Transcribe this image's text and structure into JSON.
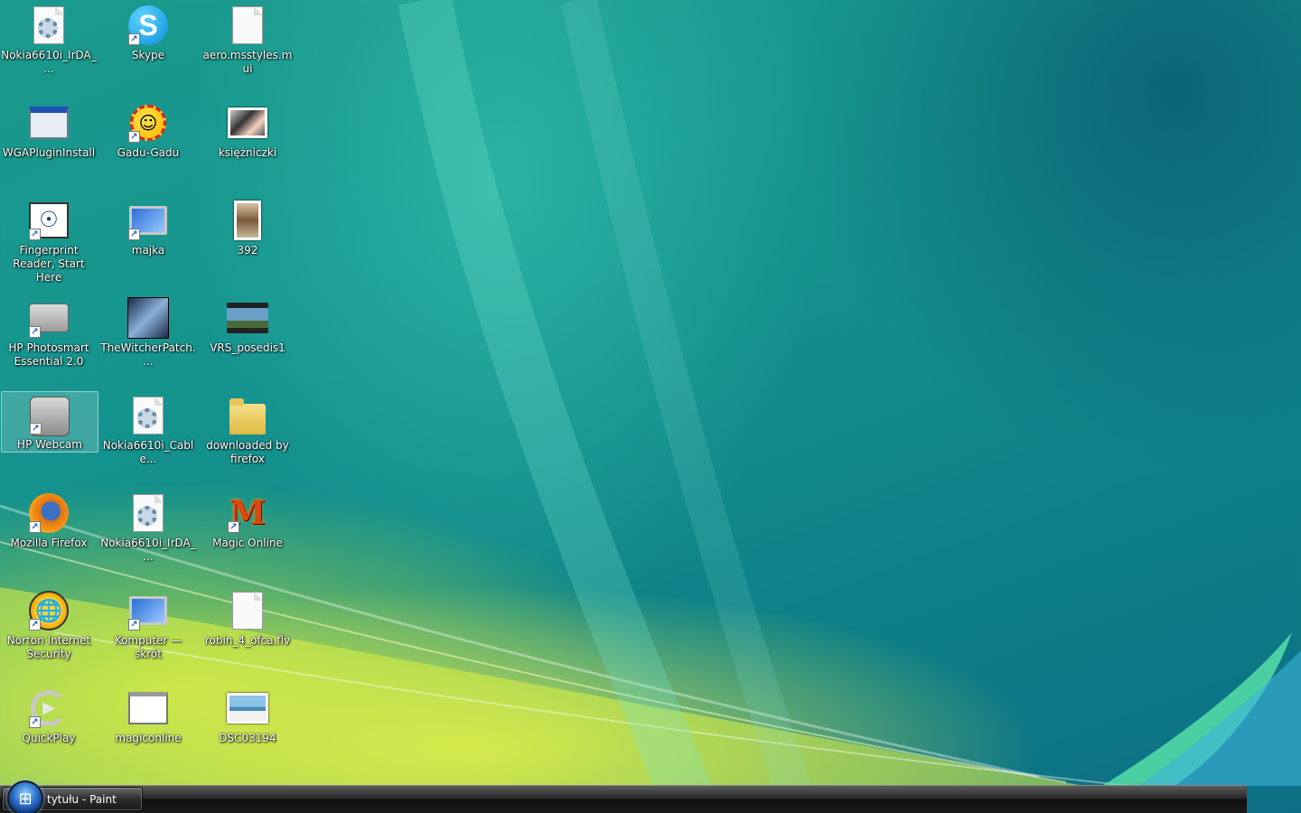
{
  "desktop": {
    "icons": [
      {
        "label": "Nokia6610i_IrDA_...",
        "icon": "settings-file-icon",
        "shortcut": false
      },
      {
        "label": "Skype",
        "icon": "skype-icon",
        "shortcut": true
      },
      {
        "label": "aero.msstyles.mui",
        "icon": "blank-file-icon",
        "shortcut": false
      },
      {
        "label": "WGAPluginInstall",
        "icon": "installer-icon",
        "shortcut": false
      },
      {
        "label": "Gadu-Gadu",
        "icon": "gadu-gadu-icon",
        "shortcut": true
      },
      {
        "label": "księżniczki",
        "icon": "photo-icon",
        "shortcut": false
      },
      {
        "label": "Fingerprint Reader, Start Here",
        "icon": "fingerprint-reader-icon",
        "shortcut": true
      },
      {
        "label": "majka",
        "icon": "computer-icon",
        "shortcut": true
      },
      {
        "label": "392",
        "icon": "photo-icon",
        "shortcut": false
      },
      {
        "label": "HP Photosmart Essential 2.0",
        "icon": "camera-icon",
        "shortcut": true
      },
      {
        "label": "TheWitcherPatch....",
        "icon": "witcher-patch-icon",
        "shortcut": false
      },
      {
        "label": "VRS_posedis1",
        "icon": "video-icon",
        "shortcut": false
      },
      {
        "label": "HP Webcam",
        "icon": "webcam-icon",
        "shortcut": true
      },
      {
        "label": "Nokia6610i_Cable...",
        "icon": "settings-file-icon",
        "shortcut": false
      },
      {
        "label": "downloaded by firefox",
        "icon": "folder-icon",
        "shortcut": false
      },
      {
        "label": "Mozilla Firefox",
        "icon": "firefox-icon",
        "shortcut": true
      },
      {
        "label": "Nokia6610i_IrDA_...",
        "icon": "settings-file-icon",
        "shortcut": false
      },
      {
        "label": "Magic Online",
        "icon": "magic-online-icon",
        "shortcut": true
      },
      {
        "label": "Norton Internet Security",
        "icon": "norton-icon",
        "shortcut": true
      },
      {
        "label": "Komputer — skrót",
        "icon": "computer-icon",
        "shortcut": true
      },
      {
        "label": "robin_4_ofca.flv",
        "icon": "blank-file-icon",
        "shortcut": false
      },
      {
        "label": "QuickPlay",
        "icon": "quickplay-icon",
        "shortcut": true
      },
      {
        "label": "magiconline",
        "icon": "web-page-icon",
        "shortcut": false
      },
      {
        "label": "DSC03194",
        "icon": "landscape-photo-icon",
        "shortcut": false
      }
    ]
  },
  "taskbar": {
    "start_icon": "windows-start-orb-icon",
    "task_label": "tytułu - Paint"
  },
  "colors": {
    "wallpaper_teal": "#118a8a",
    "wallpaper_lime": "#d8ea50",
    "taskbar": "#1a1a1a"
  }
}
